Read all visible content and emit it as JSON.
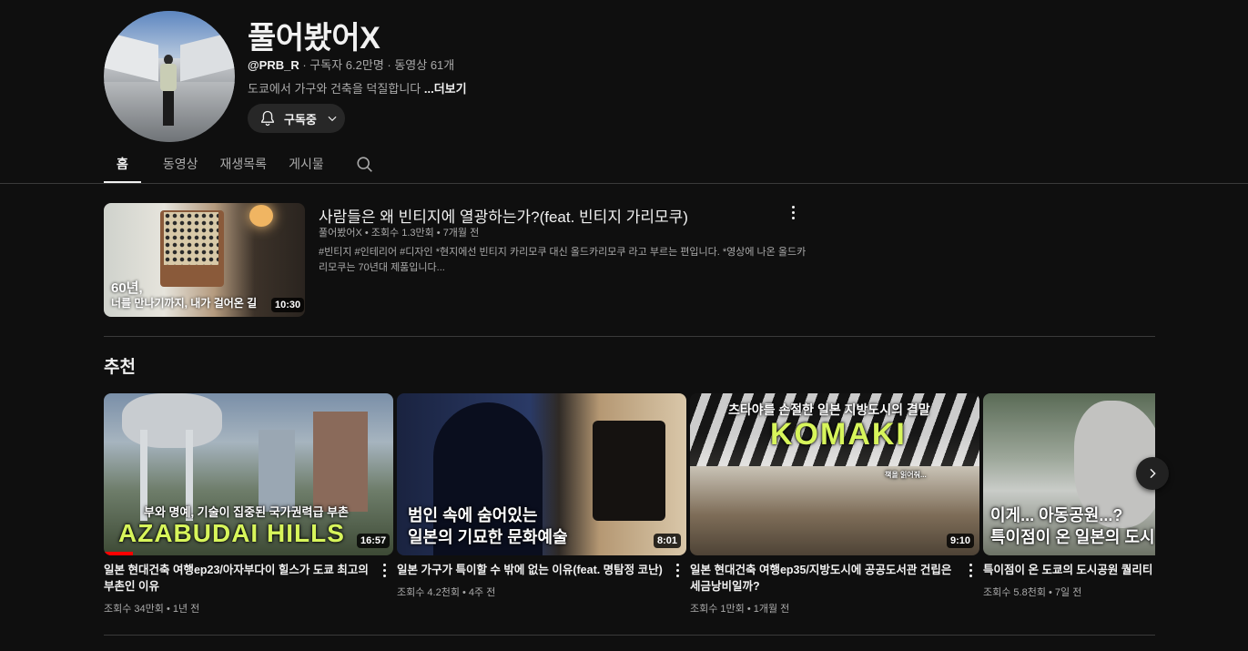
{
  "channel": {
    "name": "풀어봤어X",
    "handle": "@PRB_R",
    "stats": " · 구독자 6.2만명 · 동영상 61개",
    "description": "도쿄에서 가구와 건축을 덕질합니다 ",
    "more_label": "...더보기",
    "subscribe_label": "구독중"
  },
  "tabs": [
    {
      "label": "홈",
      "active": true
    },
    {
      "label": "동영상",
      "active": false
    },
    {
      "label": "재생목록",
      "active": false
    },
    {
      "label": "게시물",
      "active": false
    }
  ],
  "featured": {
    "title": "사람들은 왜 빈티지에 열광하는가?(feat. 빈티지 가리모쿠)",
    "meta": "풀어봤어X • 조회수 1.3만회 • 7개월 전",
    "description": "#빈티지 #인테리어 #디자인 *현지에선 빈티지 카리모쿠 대신 올드카리모쿠 라고 부르는 편입니다. *영상에 나온 올드카리모쿠는 70년대 제품입니다...",
    "overlay_line1": "60년,",
    "overlay_line2": "너를 만나기까지, 내가 걸어온 길",
    "duration": "10:30"
  },
  "section_title": "추천",
  "videos": [
    {
      "title": "일본 현대건축 여행ep23/아자부다이 힐스가 도쿄 최고의 부촌인 이유",
      "meta": "조회수 34만회 • 1년 전",
      "duration": "16:57",
      "overlay_top": "부와 명예, 기술이 집중된 국가권력급 부촌",
      "overlay_big": "AZABUDAI HILLS"
    },
    {
      "title": "일본 가구가 특이할 수 밖에 없는 이유(feat. 명탐정 코난)",
      "meta": "조회수 4.2천회 • 4주 전",
      "duration": "8:01",
      "overlay_top": "범인 속에 숨어있는",
      "overlay_big": "일본의 기묘한 문화예술"
    },
    {
      "title": "일본 현대건축 여행ep35/지방도시에 공공도서관 건립은 세금낭비일까?",
      "meta": "조회수 1만회 • 1개월 전",
      "duration": "9:10",
      "overlay_top": "츠타야를 손절한 일본 지방도시의 결말",
      "overlay_big": "KOMAKI",
      "overlay_small": "책을 읽어줘..."
    },
    {
      "title": "특이점이 온 도쿄의 도시공원 퀄리티",
      "meta": "조회수 5.8천회 • 7일 전",
      "overlay_top": "이게... 아동공원...?",
      "overlay_big": "특이점이 온 일본의 도시"
    }
  ],
  "icons": {
    "bell": "bell-icon",
    "chevron": "chevron-down-icon",
    "search": "search-icon",
    "next": "chevron-right-icon",
    "more": "more-vert-icon"
  },
  "colors": {
    "background": "#0f0f0f",
    "text": "#f1f1f1",
    "secondary_text": "#aaaaaa",
    "progress": "#ff0000",
    "overlay_lime": "#d7f55b"
  }
}
